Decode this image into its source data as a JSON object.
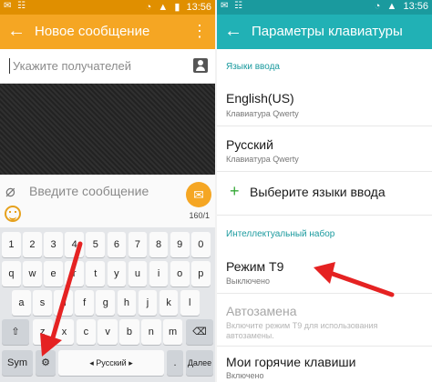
{
  "left": {
    "status": {
      "time": "13:56",
      "battery": "▮"
    },
    "appbar": {
      "title": "Новое сообщение",
      "more": "⋮"
    },
    "recipient": {
      "placeholder": "Укажите получателей"
    },
    "compose": {
      "placeholder": "Введите сообщение",
      "counter": "160/1"
    },
    "keyboard": {
      "row1": [
        "1",
        "2",
        "3",
        "4",
        "5",
        "6",
        "7",
        "8",
        "9",
        "0"
      ],
      "row2": [
        "q",
        "w",
        "e",
        "r",
        "t",
        "y",
        "u",
        "i",
        "o",
        "p"
      ],
      "row3": [
        "a",
        "s",
        "d",
        "f",
        "g",
        "h",
        "j",
        "k",
        "l"
      ],
      "row4": [
        "z",
        "x",
        "c",
        "v",
        "b",
        "n",
        "m"
      ],
      "sym": "Sym",
      "space": "◂ Русский ▸",
      "lang_dot": ".",
      "next": "Далее"
    }
  },
  "right": {
    "status": {
      "time": "13:56"
    },
    "appbar": {
      "title": "Параметры клавиатуры"
    },
    "section_input": "Языки ввода",
    "english": {
      "title": "English(US)",
      "subtitle": "Клавиатура Qwerty"
    },
    "russian": {
      "title": "Русский",
      "subtitle": "Клавиатура Qwerty"
    },
    "select_lang": "Выберите языки ввода",
    "section_smart": "Интеллектуальный набор",
    "t9": {
      "title": "Режим Т9",
      "subtitle": "Выключено"
    },
    "autocorrect": {
      "title": "Автозамена",
      "subtitle1": "Включите режим Т9 для использования",
      "subtitle2": "автозамены."
    },
    "hotkeys": {
      "title": "Мои горячие клавиши",
      "subtitle": "Включено"
    }
  },
  "colors": {
    "orange": "#f5a623",
    "teal": "#21b1b5",
    "arrow": "#e52222"
  }
}
